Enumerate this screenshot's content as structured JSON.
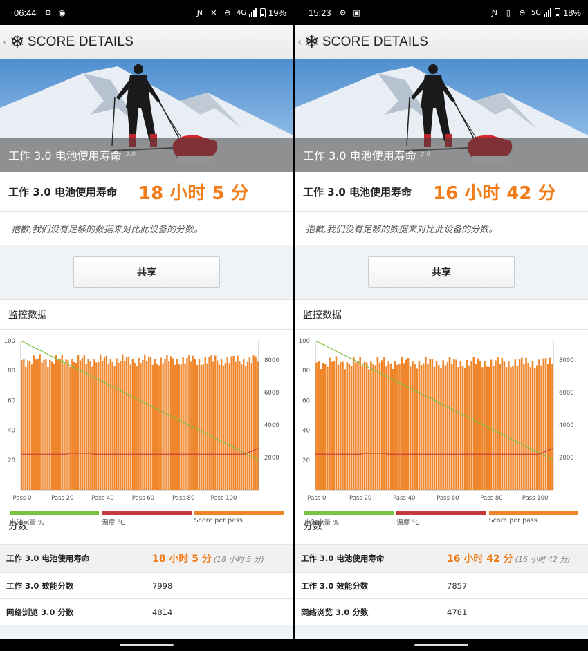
{
  "screens": [
    {
      "status": {
        "time": "06:44",
        "network": "4G",
        "battery": "19%"
      },
      "header": {
        "title": "SCORE DETAILS"
      },
      "hero": {
        "caption": "工作 3.0 电池使用寿命",
        "version": "3.0"
      },
      "score": {
        "label": "工作 3.0 电池使用寿命",
        "value": "18 小时 5 分"
      },
      "sorry": "抱歉,我们没有足够的数据来对比此设备的分数。",
      "share_label": "共享",
      "monitor_title": "监控数据",
      "chart_data": {
        "type": "line",
        "x_ticks": [
          "Pass 0",
          "Pass 20",
          "Pass 40",
          "Pass 60",
          "Pass 80",
          "Pass 100"
        ],
        "x_range": [
          0,
          118
        ],
        "left_axis": {
          "ticks": [
            "20",
            "40",
            "60",
            "80",
            "100"
          ],
          "range": [
            0,
            100
          ]
        },
        "right_axis": {
          "ticks": [
            "2000",
            "4000",
            "6000",
            "8000"
          ],
          "range": [
            0,
            9200
          ]
        },
        "passes": 118,
        "score_mean": 7998,
        "score_amplitude": 600,
        "battery_start": 100,
        "battery_end": 20,
        "temperature_level": 24,
        "temperature_end": 28,
        "legend": [
          {
            "label": "电池电量 %",
            "color": "#7cc243"
          },
          {
            "label": "温度 °C",
            "color": "#c8383a"
          },
          {
            "label": "Score per pass",
            "color": "#f0862b"
          }
        ]
      },
      "scores_title": "分数",
      "table": [
        {
          "label": "工作 3.0 电池使用寿命",
          "value": "18 小时 5 分",
          "sub": "(18 小时 5 分)"
        },
        {
          "label": "工作 3.0 效能分数",
          "value": "7998",
          "sub": ""
        },
        {
          "label": "网络浏览 3.0 分数",
          "value": "4814",
          "sub": ""
        }
      ]
    },
    {
      "status": {
        "time": "15:23",
        "network": "5G",
        "battery": "18%"
      },
      "header": {
        "title": "SCORE DETAILS"
      },
      "hero": {
        "caption": "工作 3.0 电池使用寿命",
        "version": "3.0"
      },
      "score": {
        "label": "工作 3.0 电池使用寿命",
        "value": "16 小时 42 分"
      },
      "sorry": "抱歉,我们没有足够的数据来对比此设备的分数。",
      "share_label": "共享",
      "monitor_title": "监控数据",
      "chart_data": {
        "type": "line",
        "x_ticks": [
          "Pass 0",
          "Pass 20",
          "Pass 40",
          "Pass 60",
          "Pass 80",
          "Pass 100"
        ],
        "x_range": [
          0,
          109
        ],
        "left_axis": {
          "ticks": [
            "20",
            "40",
            "60",
            "80",
            "100"
          ],
          "range": [
            0,
            100
          ]
        },
        "right_axis": {
          "ticks": [
            "2000",
            "4000",
            "6000",
            "8000"
          ],
          "range": [
            0,
            9200
          ]
        },
        "passes": 109,
        "score_mean": 7857,
        "score_amplitude": 600,
        "battery_start": 100,
        "battery_end": 20,
        "temperature_level": 24,
        "temperature_end": 28,
        "legend": [
          {
            "label": "电池电量 %",
            "color": "#7cc243"
          },
          {
            "label": "温度 °C",
            "color": "#c8383a"
          },
          {
            "label": "Score per pass",
            "color": "#f0862b"
          }
        ]
      },
      "scores_title": "分数",
      "table": [
        {
          "label": "工作 3.0 电池使用寿命",
          "value": "16 小时 42 分",
          "sub": "(16 小时 42 分)"
        },
        {
          "label": "工作 3.0 效能分数",
          "value": "7857",
          "sub": ""
        },
        {
          "label": "网络浏览 3.0 分数",
          "value": "4781",
          "sub": ""
        }
      ]
    }
  ]
}
